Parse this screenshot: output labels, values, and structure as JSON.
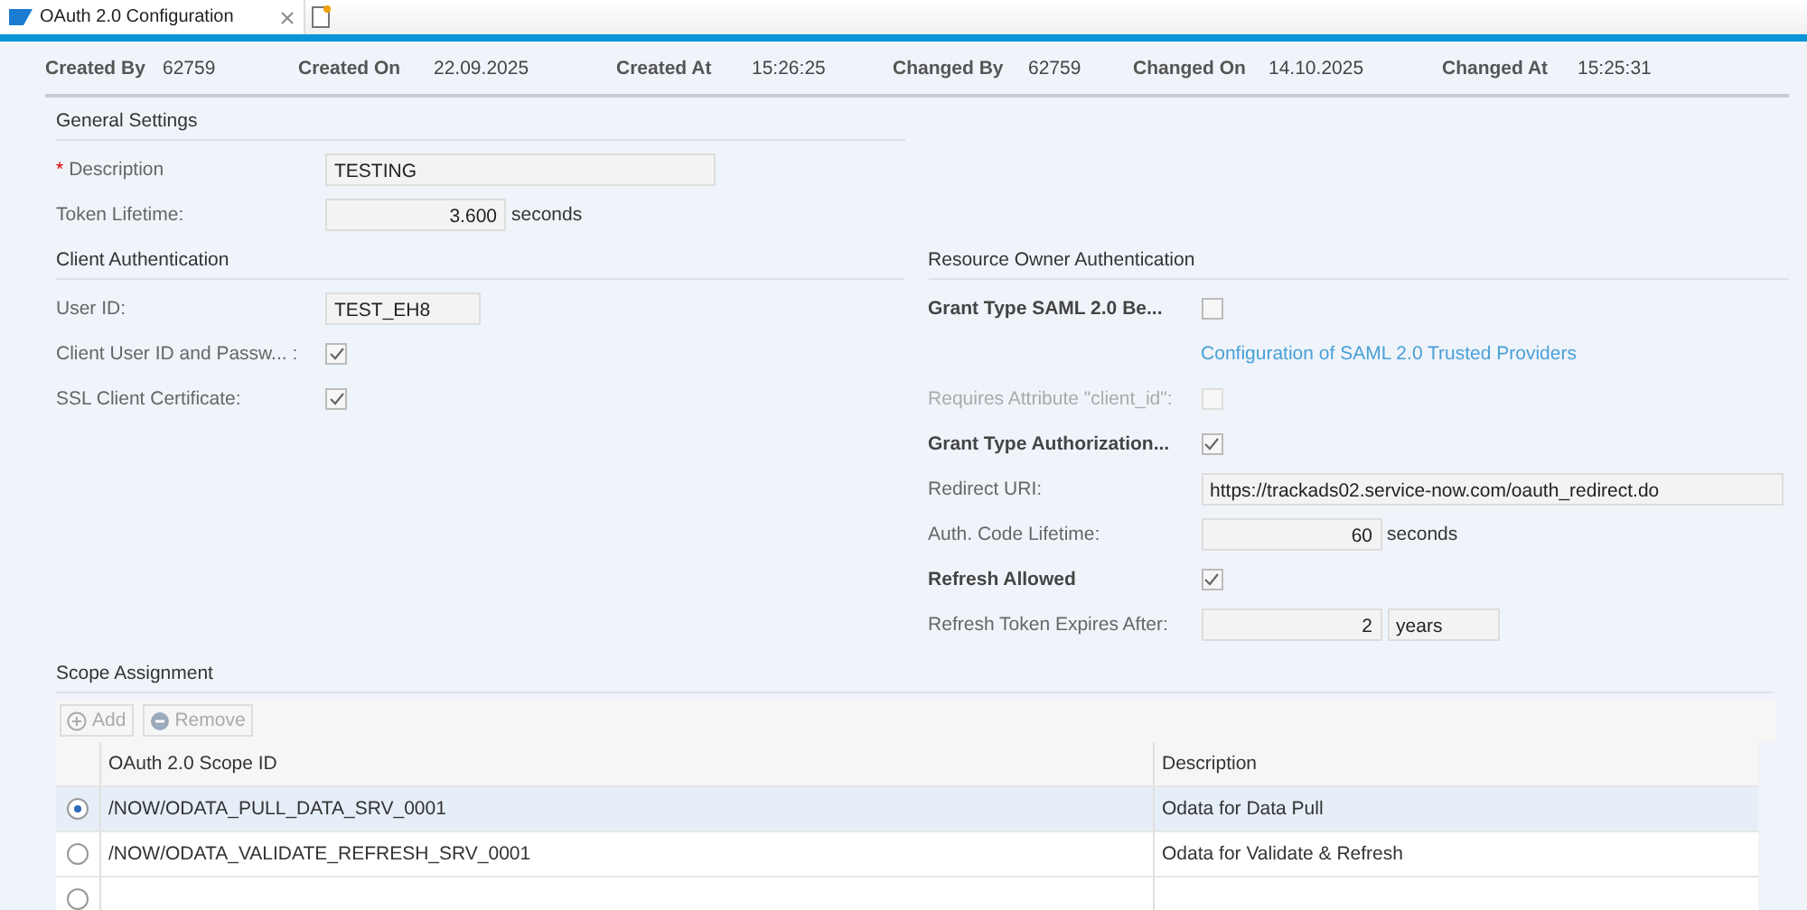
{
  "tabs": [
    {
      "title": "OAuth 2.0 Configuration"
    }
  ],
  "header": [
    {
      "label": "Created By",
      "value": "62759"
    },
    {
      "label": "Created On",
      "value": "22.09.2025"
    },
    {
      "label": "Created At",
      "value": "15:26:25"
    },
    {
      "label": "Changed By",
      "value": "62759"
    },
    {
      "label": "Changed On",
      "value": "14.10.2025"
    },
    {
      "label": "Changed At",
      "value": "15:25:31"
    }
  ],
  "general": {
    "title": "General Settings",
    "fields": [
      {
        "label": "Description",
        "kind": "text",
        "value": "TESTING",
        "marker": "*"
      },
      {
        "label": "Token Lifetime:",
        "kind": "number",
        "value": "3.600",
        "unit": "seconds"
      }
    ]
  },
  "client": {
    "title": "Client Authentication",
    "fields": [
      {
        "label": "User ID:",
        "kind": "short-text",
        "value": "TEST_EH8"
      },
      {
        "label": "Client User ID and Passw... :",
        "kind": "checkbox",
        "checked": true
      },
      {
        "label": "SSL Client Certificate:",
        "kind": "checkbox",
        "checked": true
      }
    ]
  },
  "resource_owner": {
    "title": "Resource Owner Authentication",
    "fields": [
      {
        "label": "Grant Type SAML 2.0 Be...",
        "kind": "checkbox",
        "checked": false,
        "disabled": false,
        "bold": true
      },
      {
        "kind": "link",
        "value": "Configuration of SAML 2.0 Trusted Providers"
      },
      {
        "label": "Requires Attribute \"client_id\":",
        "kind": "checkbox",
        "checked": false,
        "disabled": true,
        "bold": false
      },
      {
        "label": "Grant Type Authorization...",
        "kind": "checkbox",
        "checked": true,
        "disabled": false,
        "bold": true
      },
      {
        "label": "Redirect URI:",
        "kind": "url",
        "value": "https://trackads02.service-now.com/oauth_redirect.do"
      },
      {
        "label": "Auth. Code Lifetime:",
        "kind": "number",
        "value": "60",
        "unit": "seconds"
      },
      {
        "label": "Refresh Allowed",
        "kind": "checkbox",
        "checked": true,
        "disabled": false,
        "bold": true
      },
      {
        "label": "Refresh Token Expires After:",
        "kind": "number",
        "value": "2",
        "unit_field": "years"
      }
    ]
  },
  "scope": {
    "title": "Scope Assignment",
    "buttons": [
      {
        "label": "Add",
        "kind": "add"
      },
      {
        "label": "Remove",
        "kind": "remove"
      }
    ],
    "columns": [
      "OAuth 2.0 Scope ID",
      "Description"
    ],
    "rows": [
      {
        "selected": true,
        "cells": [
          "/NOW/ODATA_PULL_DATA_SRV_0001",
          "Odata for Data Pull"
        ]
      },
      {
        "selected": false,
        "cells": [
          "/NOW/ODATA_VALIDATE_REFRESH_SRV_0001",
          "Odata for Validate & Refresh"
        ]
      },
      {
        "selected": false,
        "cells": []
      }
    ]
  }
}
